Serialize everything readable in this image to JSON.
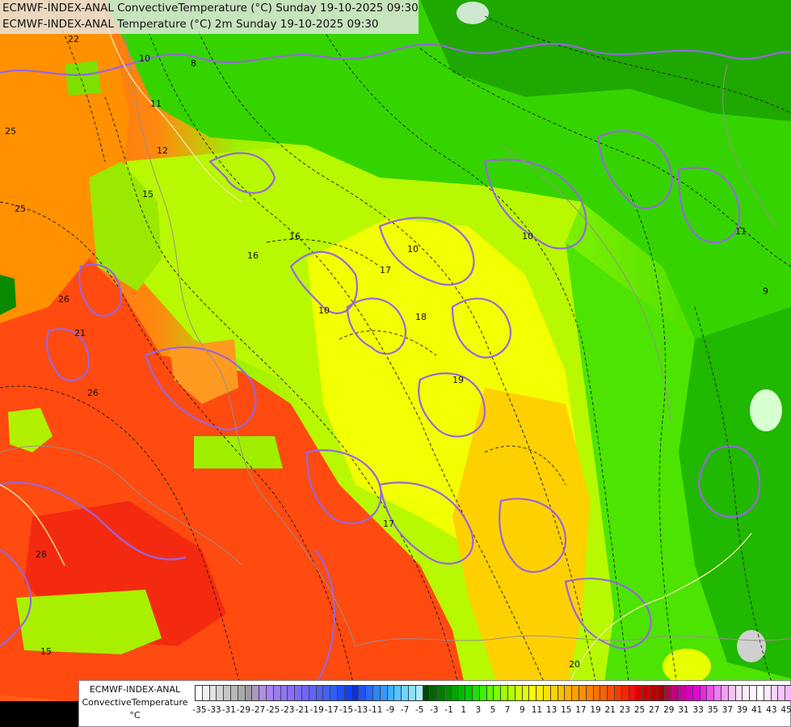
{
  "title": {
    "line1": "ECMWF-INDEX-ANAL ConvectiveTemperature (°C) Sunday 19-10-2025 09:30",
    "line2": "ECMWF-INDEX-ANAL Temperature (°C) 2m Sunday 19-10-2025 09:30"
  },
  "legend": {
    "model": "ECMWF-INDEX-ANAL",
    "parameter": "ConvectiveTemperature",
    "unit": "°C",
    "ticks": [
      "-35",
      "-33",
      "-31",
      "-29",
      "-27",
      "-25",
      "-23",
      "-21",
      "-19",
      "-17",
      "-15",
      "-13",
      "-11",
      "-9",
      "-7",
      "-5",
      "-3",
      "-1",
      "1",
      "3",
      "5",
      "7",
      "9",
      "11",
      "13",
      "15",
      "17",
      "19",
      "21",
      "23",
      "25",
      "27",
      "29",
      "31",
      "33",
      "35",
      "37",
      "39",
      "41",
      "43",
      "45"
    ],
    "colors": [
      "#ffffff",
      "#f1f1f1",
      "#e3e3e3",
      "#d4d4d4",
      "#c6c6c6",
      "#b8b8b8",
      "#aaaaaa",
      "#9c9c9c",
      "#a799c4",
      "#b08ee0",
      "#a584f0",
      "#9a7cf5",
      "#8f74fa",
      "#8a6cff",
      "#7d69ff",
      "#6e66ff",
      "#5f63ff",
      "#5060ff",
      "#4060ff",
      "#2f5dff",
      "#2050ff",
      "#1140f0",
      "#0a30e0",
      "#1c52ff",
      "#2a6bff",
      "#2f83ff",
      "#3599ff",
      "#3fb0ff",
      "#55c4ff",
      "#6fd5ff",
      "#8ee2ff",
      "#a8eeff",
      "#004a00",
      "#006400",
      "#007a00",
      "#008f00",
      "#00a300",
      "#00b800",
      "#00cc00",
      "#1ee000",
      "#3ef200",
      "#5dff00",
      "#7dff00",
      "#9bff00",
      "#b6ff00",
      "#cfff00",
      "#e6ff00",
      "#ffff00",
      "#fff000",
      "#ffe000",
      "#ffd000",
      "#ffc000",
      "#ffb000",
      "#ffa000",
      "#ff9000",
      "#ff8000",
      "#ff7000",
      "#ff6000",
      "#ff4c00",
      "#ff3800",
      "#ff2400",
      "#f01010",
      "#e00000",
      "#cc0000",
      "#b80000",
      "#a40000",
      "#b4004a",
      "#c0007a",
      "#cc00a0",
      "#d800c0",
      "#e400d8",
      "#ee22e6",
      "#f050ee",
      "#f07af2",
      "#f2a0f4",
      "#f4c4f6",
      "#f8e0fa",
      "#fbeefc",
      "#fdf6fe",
      "#ffffff",
      "#fde6ff",
      "#fbd6ff",
      "#f9c6ff",
      "#f7b6ff"
    ]
  },
  "map_labels": [
    "22",
    "10",
    "8",
    "11",
    "25",
    "25",
    "12",
    "26",
    "21",
    "15",
    "16",
    "16",
    "10",
    "10",
    "17",
    "18",
    "19",
    "10",
    "11",
    "9",
    "26",
    "28",
    "15",
    "20",
    "17"
  ]
}
